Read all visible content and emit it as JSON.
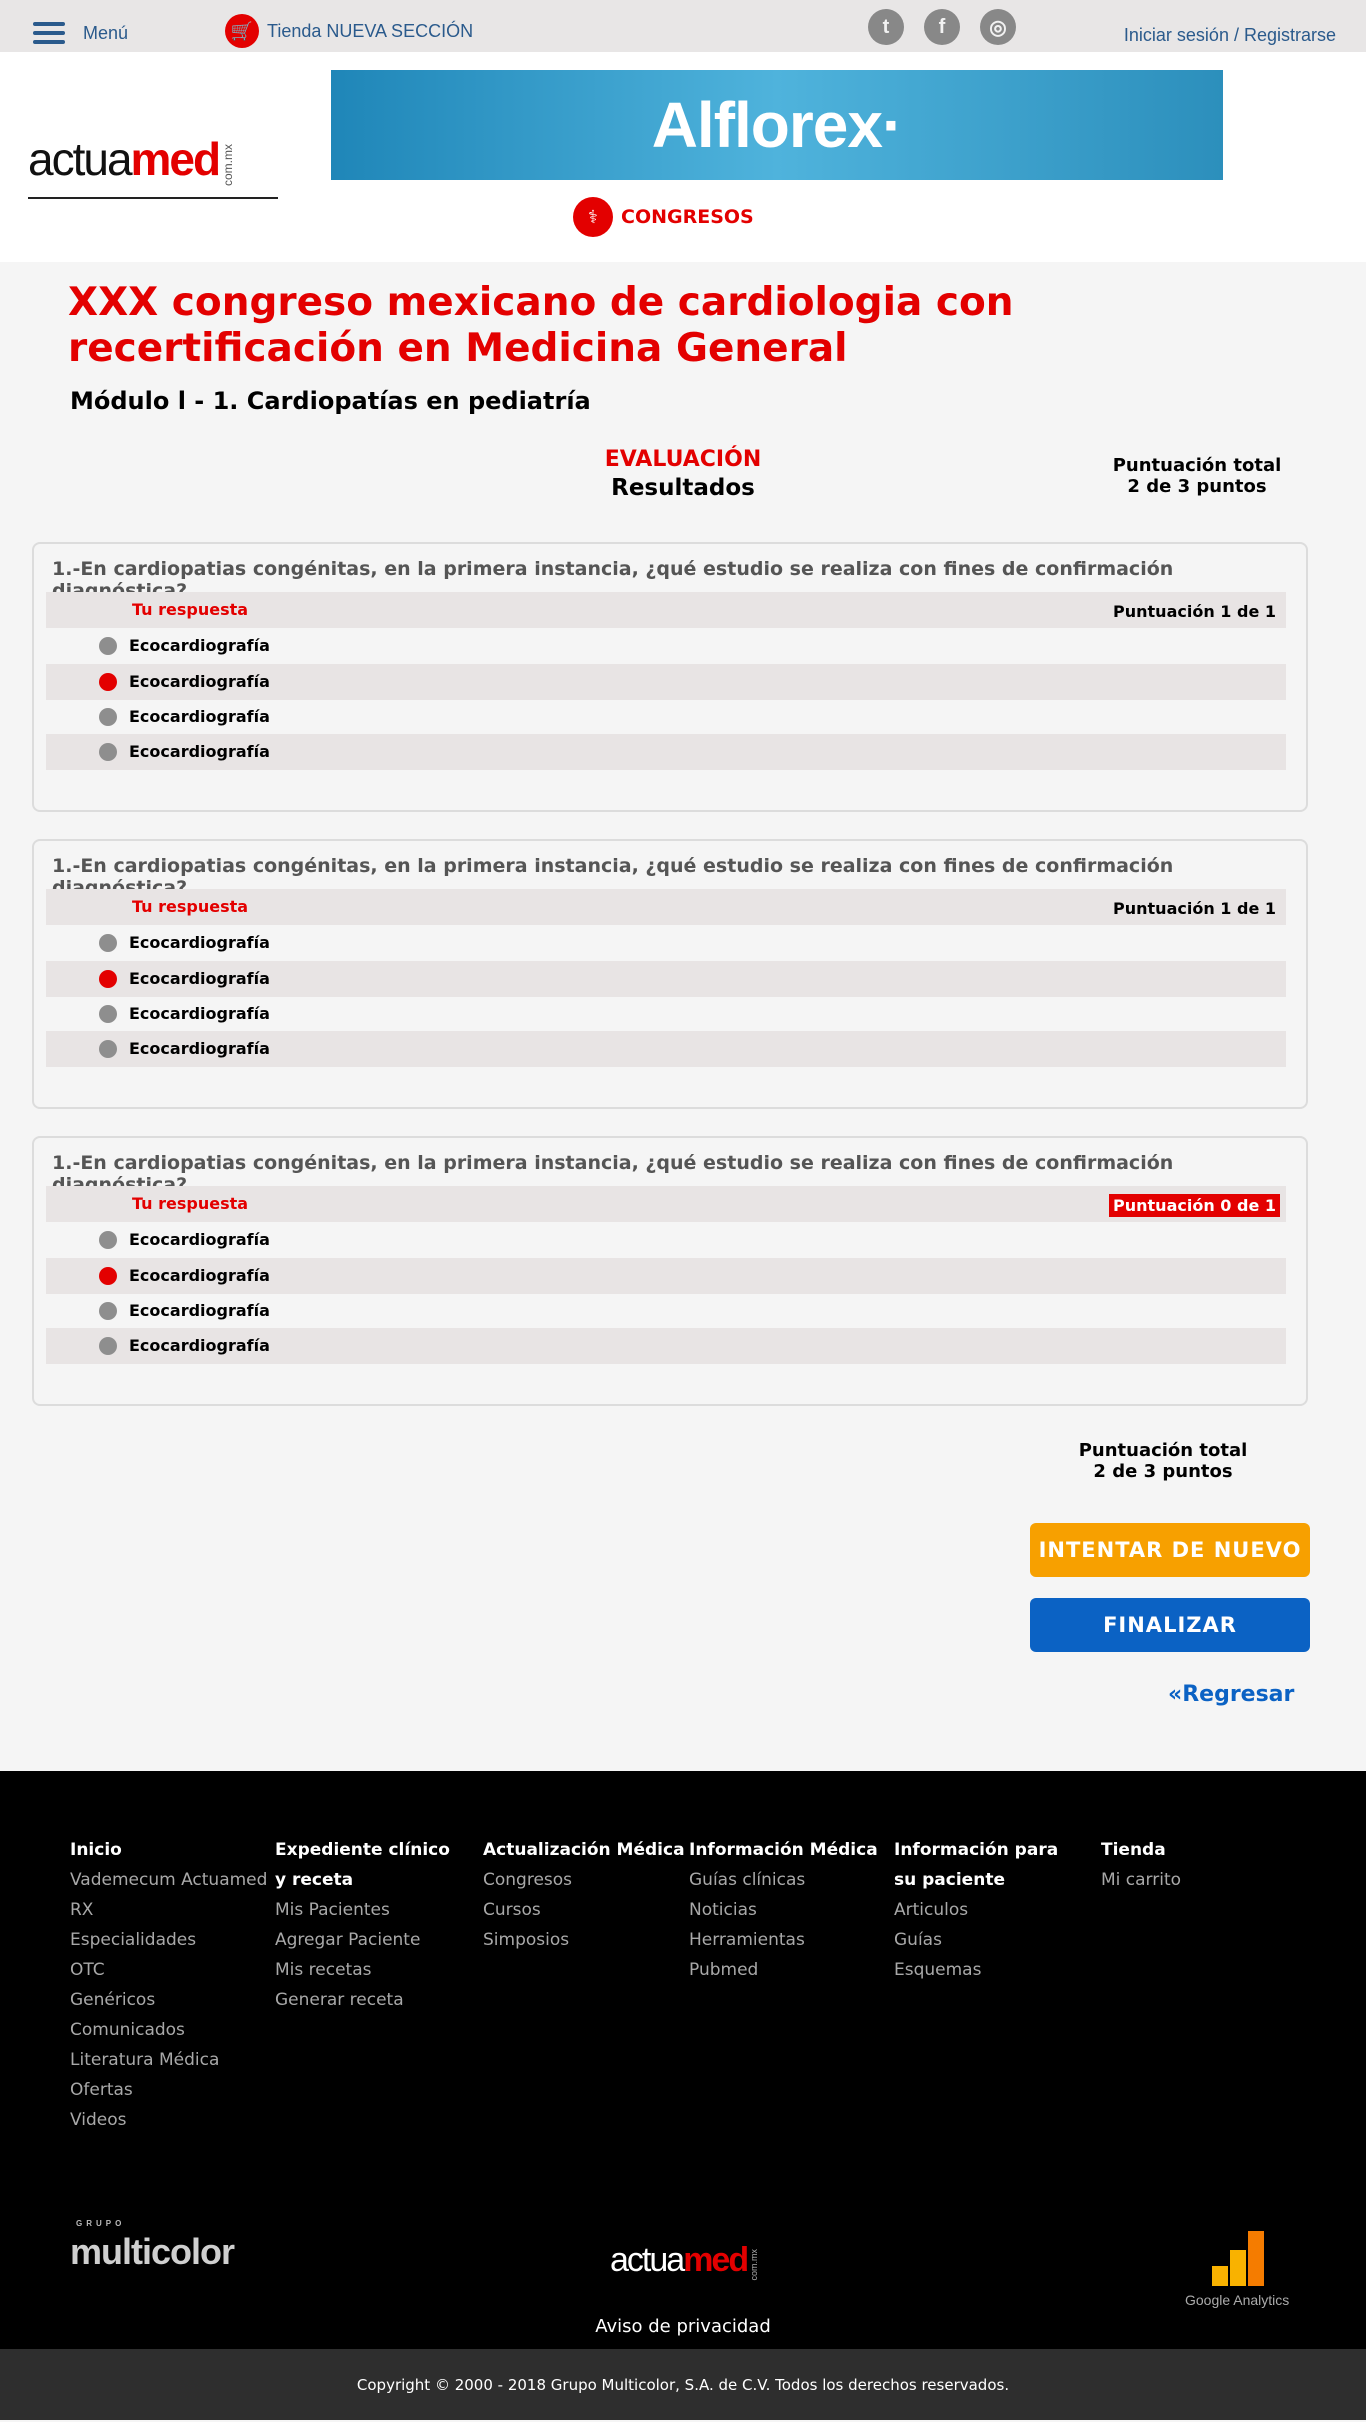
{
  "topbar": {
    "menu_label": "Menú",
    "store_label": "Tienda NUEVA SECCIÓN",
    "login_label": "Iniciar sesión / Registrarse",
    "social": [
      "t",
      "f",
      "◎"
    ]
  },
  "header": {
    "logo_actua": "actua",
    "logo_med": "med",
    "logo_com": "com.mx",
    "banner_text": "Alflorex·",
    "congresos_label": "CONGRESOS"
  },
  "page": {
    "title": "XXX congreso mexicano de cardiologia con recertificación en Medicina General",
    "subtitle": "Módulo l - 1. Cardiopatías en pediatría",
    "evaluation_label": "EVALUACIÓN",
    "results_label": "Resultados",
    "total_label": "Puntuación total",
    "total_value": "2 de 3 puntos"
  },
  "questions": [
    {
      "text": "1.-En cardiopatias congénitas, en la primera instancia, ¿qué estudio se realiza con fines de confirmación diagnóstica?",
      "answer_label": "Tu respuesta",
      "score": "Puntuación 1 de 1",
      "options": [
        "Ecocardiografía",
        "Ecocardiografía",
        "Ecocardiografía",
        "Ecocardiografía"
      ]
    },
    {
      "text": "1.-En cardiopatias congénitas, en la primera instancia, ¿qué estudio se realiza con fines de confirmación diagnóstica?",
      "answer_label": "Tu respuesta",
      "score": "Puntuación 1 de 1",
      "options": [
        "Ecocardiografía",
        "Ecocardiografía",
        "Ecocardiografía",
        "Ecocardiografía"
      ]
    },
    {
      "text": "1.-En cardiopatias congénitas, en la primera instancia, ¿qué estudio se realiza con fines de confirmación diagnóstica?",
      "answer_label": "Tu respuesta",
      "score": "Puntuación 0 de 1",
      "options": [
        "Ecocardiografía",
        "Ecocardiografía",
        "Ecocardiografía",
        "Ecocardiografía"
      ]
    }
  ],
  "actions": {
    "retry_label": "INTENTAR DE NUEVO",
    "finish_label": "FINALIZAR",
    "back_label": "«Regresar"
  },
  "footer": {
    "col1": [
      "Inicio",
      "Vademecum Actuamed",
      "RX",
      "Especialidades",
      "OTC",
      "Genéricos",
      "Comunicados",
      "Literatura Médica",
      "Ofertas",
      "Videos"
    ],
    "col2": [
      "Expediente clínico",
      "y receta",
      "Mis Pacientes",
      "Agregar Paciente",
      "Mis recetas",
      "Generar receta"
    ],
    "col3": [
      "Actualización Médica",
      "Congresos",
      "Cursos",
      "Simposios"
    ],
    "col4": [
      "Información Médica",
      "Guías clínicas",
      "Noticias",
      "Herramientas",
      "Pubmed"
    ],
    "col5": [
      "Información para",
      "su paciente",
      "Articulos",
      "Guías",
      "Esquemas"
    ],
    "col6": [
      "Tienda",
      "Mi carrito"
    ],
    "multicolor_small": "GRUPO",
    "multicolor": "multicolor",
    "privacy_label": "Aviso de privacidad",
    "analytics_label": "Google Analytics",
    "copyright": "Copyright © 2000 - 2018 Grupo Multicolor, S.A. de C.V. Todos los derechos reservados."
  },
  "colors": {
    "accent_red": "#e30000",
    "orange": "#f7a000",
    "blue": "#0b62c4",
    "link": "#2a5a8c"
  }
}
